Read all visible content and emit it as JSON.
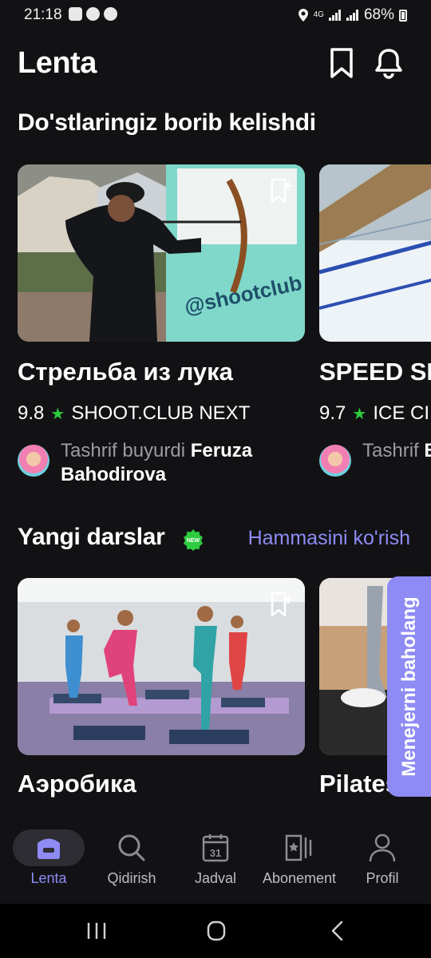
{
  "status_bar": {
    "time": "21:18",
    "network": "4G",
    "battery": "68%"
  },
  "header": {
    "title": "Lenta"
  },
  "friends_section": {
    "title": "Do'stlaringiz borib kelishdi",
    "cards": [
      {
        "title": "Стрельба из лука",
        "rating": "9.8",
        "club": "SHOOT.CLUB NEXT",
        "visit_prefix": "Tashrif buyurdi",
        "visitor": "Feruza Bahodirova",
        "image_text": "@shootclub"
      },
      {
        "title": "SPEED SK",
        "rating": "9.7",
        "club": "ICE CI",
        "visit_prefix": "Tashrif",
        "visitor": "Bahodi"
      }
    ]
  },
  "lessons_section": {
    "title": "Yangi darslar",
    "badge": "NEW",
    "see_all": "Hammasini ko'rish",
    "cards": [
      {
        "title": "Аэробика"
      },
      {
        "title": "Pilates"
      }
    ]
  },
  "feedback": {
    "label": "Menejerni baholang"
  },
  "bottom_nav": {
    "items": [
      {
        "label": "Lenta",
        "active": true
      },
      {
        "label": "Qidirish"
      },
      {
        "label": "Jadval",
        "calendar_day": "31"
      },
      {
        "label": "Abonement"
      },
      {
        "label": "Profil"
      }
    ]
  },
  "colors": {
    "background": "#121214",
    "accent": "#8e8bf5",
    "star": "#2ecc40",
    "muted_text": "#9b9ba3"
  }
}
